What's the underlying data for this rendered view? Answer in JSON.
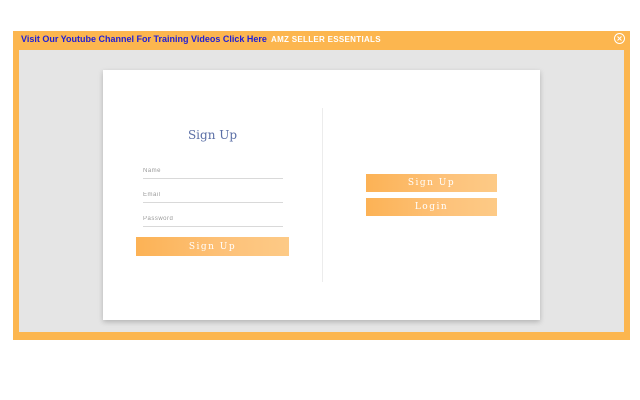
{
  "topbar": {
    "youtube_link": "Visit Our Youtube Channel For Training Videos Click Here",
    "brand": "AMZ SELLER ESSENTIALS",
    "close_label": "X"
  },
  "form": {
    "title": "Sign Up",
    "name_placeholder": "Name",
    "email_placeholder": "Email",
    "password_placeholder": "Password",
    "submit_label": "Sign Up"
  },
  "side_actions": {
    "signup_label": "Sign Up",
    "login_label": "Login"
  },
  "colors": {
    "accent": "#fcb64f",
    "link": "#1f1fd6",
    "title": "#5b6fa6",
    "panel_bg": "#e5e5e5"
  }
}
